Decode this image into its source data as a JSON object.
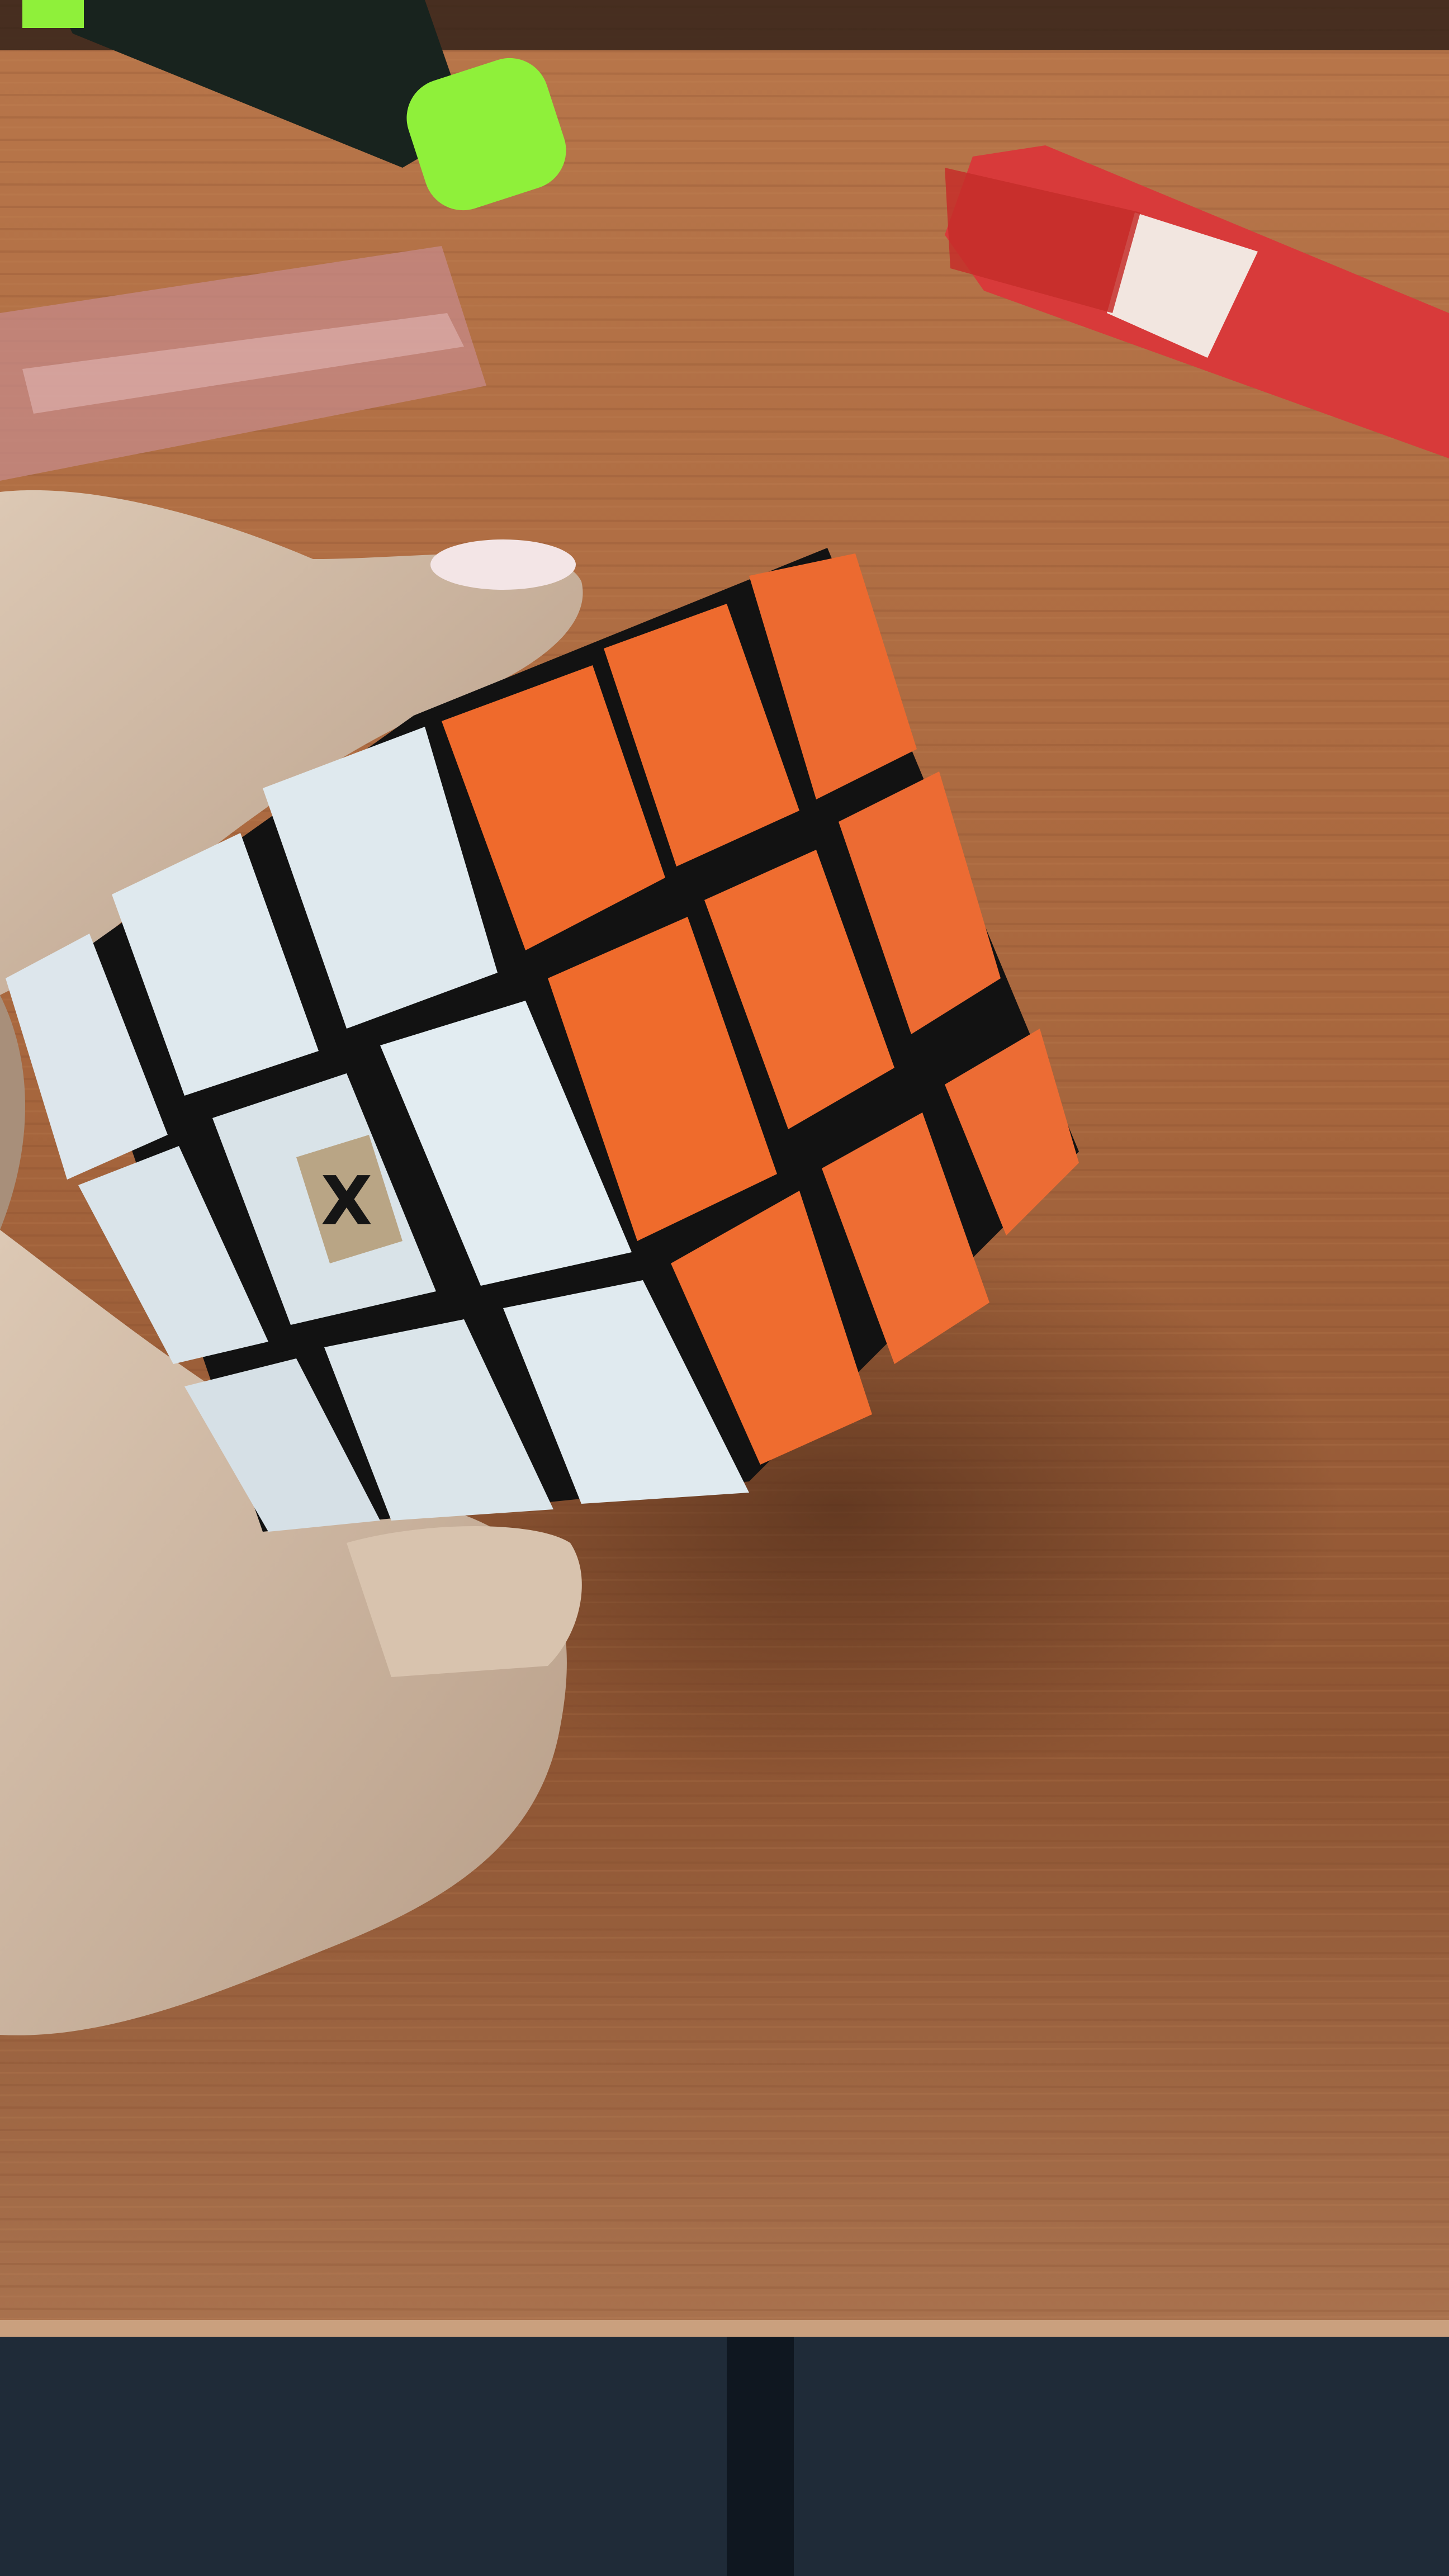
{
  "scene": {
    "description_free": true,
    "colors": {
      "table_light": "#b8764a",
      "table_mid": "#9c5f38",
      "table_dark": "#6a3d24",
      "table_edge": "#caa07e",
      "floor": "#1f2b38",
      "cube_body": "#121212",
      "sticker_white": "#dfe9ee",
      "sticker_orange": "#ee6a2e",
      "skin": "#d6c1ac",
      "skin_shadow": "#a88f7a",
      "highlighter_body": "#18231e",
      "highlighter_cap": "#8ff03a",
      "marker_red": "#d83a3a",
      "marker_band": "#f2e6e0",
      "ruler": "#c58a88",
      "logo_bg": "#b9a585"
    },
    "objects": [
      {
        "name": "rubiks-cube",
        "faces": [
          "white",
          "orange"
        ],
        "grid": "3x3"
      },
      {
        "name": "hand"
      },
      {
        "name": "green-highlighter"
      },
      {
        "name": "red-marker"
      },
      {
        "name": "plastic-ruler"
      },
      {
        "name": "wooden-table"
      }
    ],
    "logo_mark": "X"
  }
}
